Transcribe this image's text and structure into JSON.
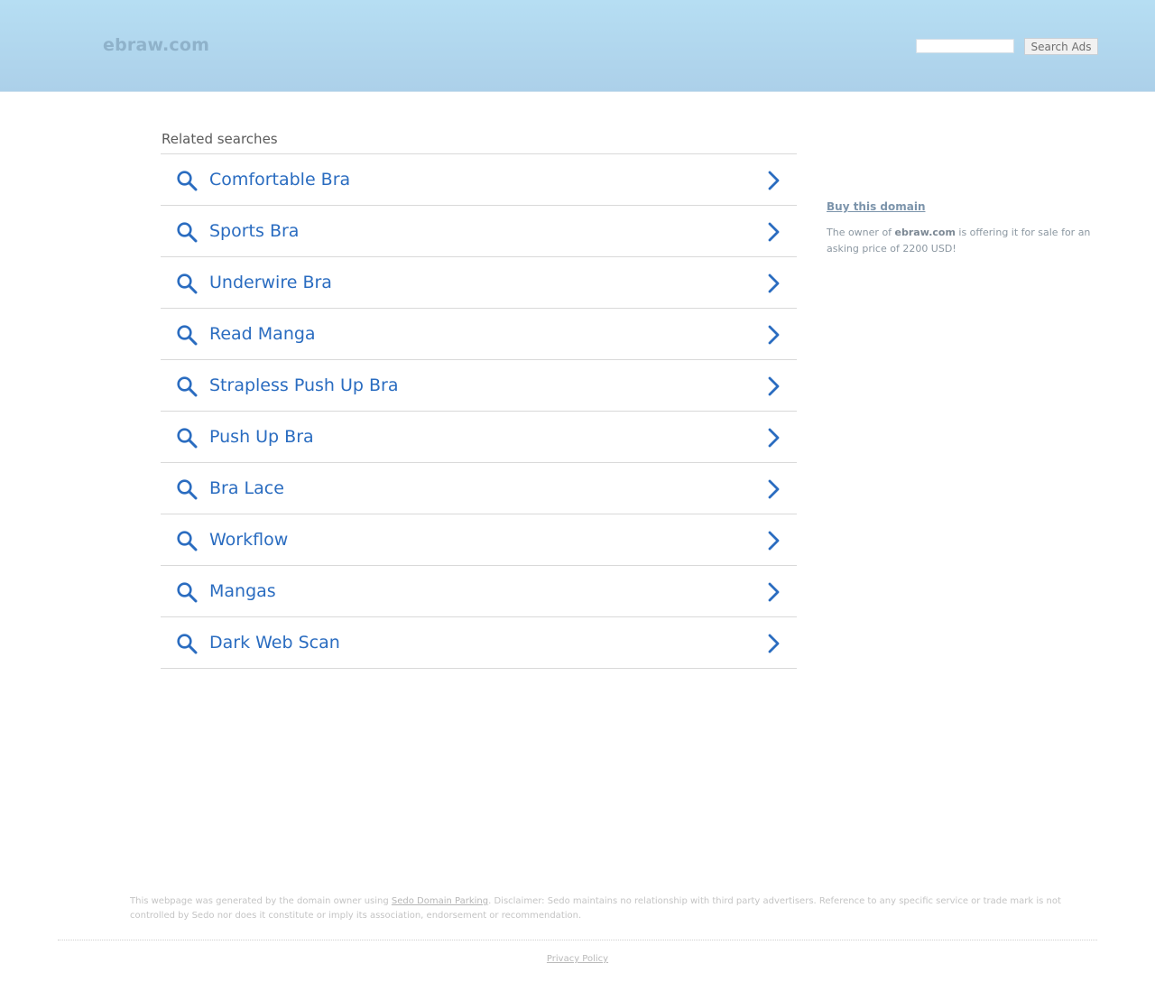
{
  "header": {
    "site_name": "ebraw.com",
    "search": {
      "value": "",
      "placeholder": ""
    },
    "search_button_label": "Search Ads"
  },
  "related": {
    "title": "Related searches",
    "items": [
      {
        "label": "Comfortable Bra"
      },
      {
        "label": "Sports Bra"
      },
      {
        "label": "Underwire Bra"
      },
      {
        "label": "Read Manga"
      },
      {
        "label": "Strapless Push Up Bra"
      },
      {
        "label": "Push Up Bra"
      },
      {
        "label": "Bra Lace"
      },
      {
        "label": "Workflow"
      },
      {
        "label": "Mangas"
      },
      {
        "label": "Dark Web Scan"
      }
    ],
    "item_icon": "search-icon",
    "item_arrow_icon": "chevron-right-icon"
  },
  "sidebar": {
    "buy_link": "Buy this domain",
    "offer_prefix": "The owner of ",
    "offer_domain": "ebraw.com",
    "offer_suffix": " is offering it for sale for an asking price of 2200 USD!"
  },
  "footer": {
    "disclaimer_prefix": "This webpage was generated by the domain owner using ",
    "disclaimer_link": "Sedo Domain Parking",
    "disclaimer_suffix": ". Disclaimer: Sedo maintains no relationship with third party advertisers. Reference to any specific service or trade mark is not controlled by Sedo nor does it constitute or imply its association, endorsement or recommendation.",
    "privacy_label": "Privacy Policy"
  },
  "colors": {
    "header_top": "#b6def3",
    "header_bottom": "#acd0e9",
    "link_blue": "#2a6cc0",
    "divider": "#d9d9d9"
  }
}
